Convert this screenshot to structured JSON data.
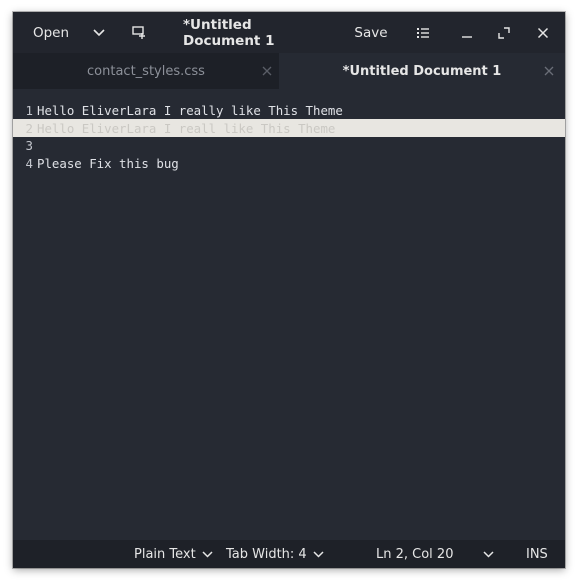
{
  "header": {
    "open_label": "Open",
    "title": "*Untitled Document 1",
    "save_label": "Save"
  },
  "tabs": [
    {
      "label": "contact_styles.css",
      "active": false
    },
    {
      "label": "*Untitled Document 1",
      "active": true
    }
  ],
  "editor": {
    "lines": [
      {
        "num": "1",
        "text": "Hello EliverLara I really like This Theme"
      },
      {
        "num": "2",
        "text": "Hello EliverLara I reall like This Theme"
      },
      {
        "num": "3",
        "text": ""
      },
      {
        "num": "4",
        "text": "Please Fix this bug"
      }
    ],
    "current_line": 2
  },
  "status": {
    "language": "Plain Text",
    "tab_width": "Tab Width: 4",
    "position": "Ln 2, Col 20",
    "mode": "INS"
  },
  "icons": {
    "open_menu": "chevron-down-icon",
    "new_tab": "new-document-icon",
    "menu": "hamburger-list-icon",
    "minimize": "minimize-icon",
    "maximize": "maximize-icon",
    "close": "close-icon"
  },
  "colors": {
    "window_bg": "#262a33",
    "headerbar_bg": "#22252d",
    "tabbar_bg": "#1d2027",
    "current_line_bg": "#e8e6e1",
    "text": "#dfe1e6"
  }
}
